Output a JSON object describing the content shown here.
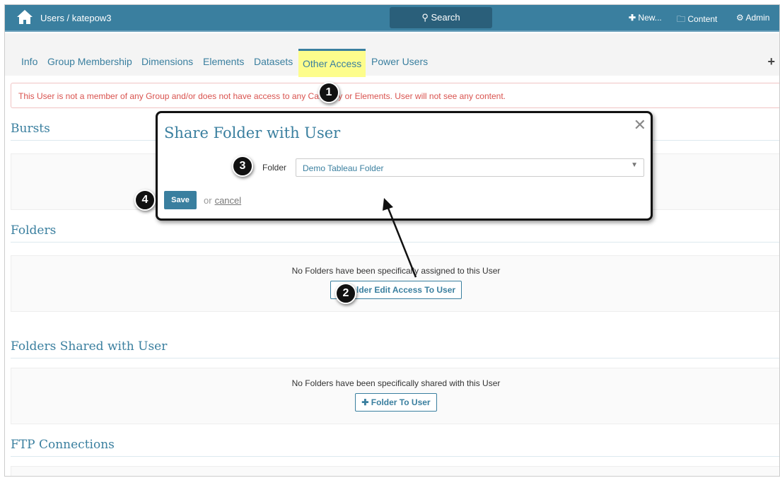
{
  "header": {
    "breadcrumb": "Users / katepow3",
    "search": "Search",
    "new": "New...",
    "content": "Content",
    "admin": "Admin"
  },
  "tabs": [
    "Info",
    "Group Membership",
    "Dimensions",
    "Elements",
    "Datasets",
    "Other Access",
    "Power Users"
  ],
  "alert": "This User is not a member of any Group and/or does not have access to any Category or Elements. User will not see any content.",
  "sections": {
    "bursts": {
      "title": "Bursts"
    },
    "folders": {
      "title": "Folders",
      "empty": "No Folders have been specifically assigned to this User",
      "button": "Folder Edit Access To User"
    },
    "shared": {
      "title": "Folders Shared with User",
      "empty": "No Folders have been specifically shared with this User",
      "button": "Folder To User"
    },
    "ftp": {
      "title": "FTP Connections"
    }
  },
  "modal": {
    "title": "Share Folder with User",
    "close": "✕",
    "folder_label": "Folder",
    "folder_value": "Demo Tableau Folder",
    "save": "Save",
    "or": "or",
    "cancel": "cancel"
  },
  "badges": [
    "1",
    "2",
    "3",
    "4"
  ]
}
